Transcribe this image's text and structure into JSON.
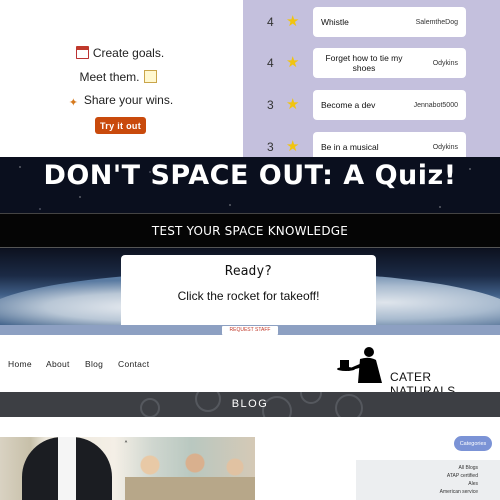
{
  "goals_app": {
    "lines": [
      "Create goals.",
      "Meet them.",
      "Share your wins."
    ],
    "icons": [
      "calendar-icon",
      "memo-icon",
      "party-popper-icon"
    ],
    "cta_label": "Try it out",
    "accent": "#c94a0c",
    "list_bg": "#c4c0dd",
    "items": [
      {
        "count": "4",
        "title": "Whistle",
        "user": "SalemtheDog"
      },
      {
        "count": "4",
        "title": "Forget how to tie my shoes",
        "user": "Odykins"
      },
      {
        "count": "3",
        "title": "Become a dev",
        "user": "Jennabot5000"
      },
      {
        "count": "3",
        "title": "Be in a musical",
        "user": "Odykins"
      }
    ]
  },
  "space_quiz": {
    "title": "DON'T SPACE OUT: A Quiz!",
    "subtitle": "TEST YOUR SPACE KNOWLEDGE",
    "card_heading": "Ready?",
    "card_text": "Click the rocket for takeoff!"
  },
  "cater": {
    "top_badge": "REQUEST STAFF",
    "nav": [
      "Home",
      "About",
      "Blog",
      "Contact"
    ],
    "brand": "CATER NATURALS",
    "section_title": "BLOG",
    "categories_label": "Categories",
    "categories": [
      "All Blogs",
      "ATAP certified",
      "Ales",
      "American service"
    ],
    "band_color": "#3d3f44",
    "accent": "#7b93d6"
  }
}
